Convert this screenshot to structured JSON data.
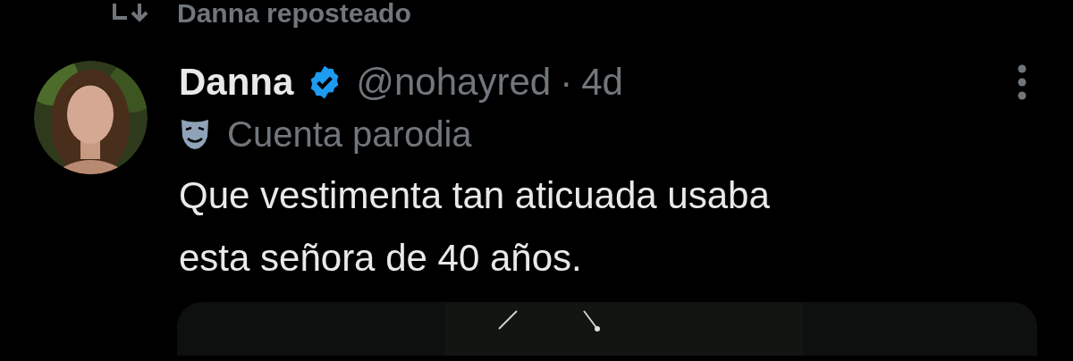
{
  "repost": {
    "label": "Danna reposteado"
  },
  "tweet": {
    "name": "Danna",
    "verified": true,
    "handle": "@nohayred",
    "separator": "·",
    "time": "4d",
    "account_label": "Cuenta parodia",
    "text": "Que vestimenta tan aticuada usaba esta señora de 40 años."
  }
}
